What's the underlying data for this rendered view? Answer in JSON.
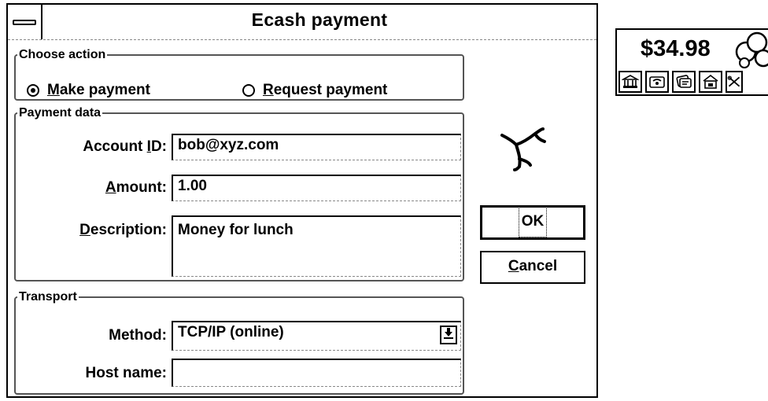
{
  "dialog": {
    "title": "Ecash payment",
    "choose_action": {
      "legend": "Choose action",
      "make_payment": {
        "mnemonic": "M",
        "rest": "ake payment",
        "selected": true
      },
      "request_payment": {
        "mnemonic": "R",
        "rest": "equest payment",
        "selected": false
      }
    },
    "payment_data": {
      "legend": "Payment data",
      "account_label": {
        "pre": "Account ",
        "mnemonic": "I",
        "post": "D:"
      },
      "account_value": "bob@xyz.com",
      "amount_label": {
        "mnemonic": "A",
        "post": "mount:"
      },
      "amount_value": "1.00",
      "description_label": {
        "mnemonic": "D",
        "post": "escription:"
      },
      "description_value": "Money for lunch"
    },
    "transport": {
      "legend": "Transport",
      "method_label": "Method:",
      "method_value": "TCP/IP (online)",
      "host_label": "Host name:",
      "host_value": ""
    },
    "buttons": {
      "ok_label": "OK",
      "cancel": {
        "mnemonic": "C",
        "rest": "ancel"
      }
    },
    "icons": [
      "system-menu-icon",
      "busy-cursor-icon",
      "dropdown-arrow-icon"
    ]
  },
  "wallet": {
    "balance": "$34.98",
    "icons": [
      "coins-icon",
      "bank-icon",
      "wallet-icon",
      "payment-icon",
      "shop-icon",
      "tools-icon"
    ]
  }
}
